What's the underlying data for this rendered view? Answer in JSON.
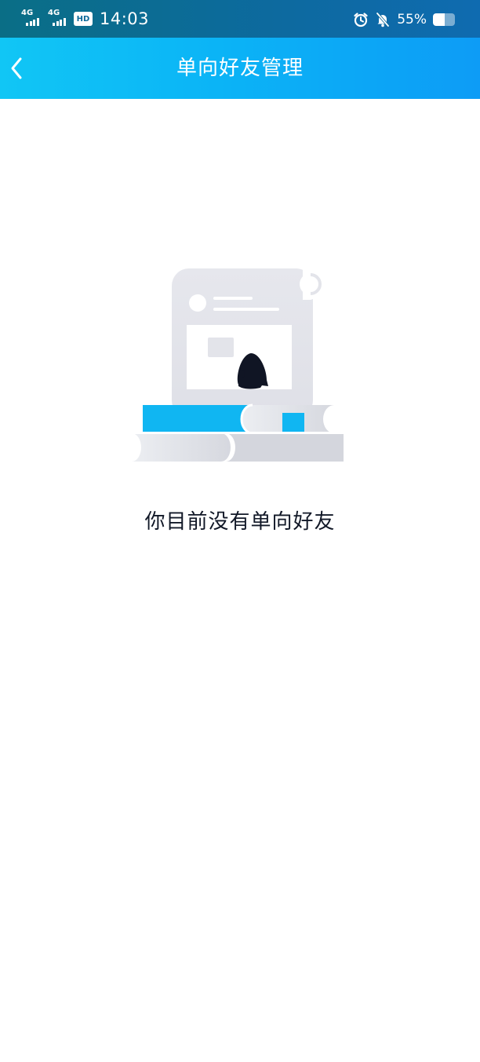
{
  "status_bar": {
    "network_1": "4G",
    "network_2": "4G",
    "hd_badge": "HD",
    "time": "14:03",
    "battery_percent_text": "55%",
    "battery_level": 0.55,
    "icons": [
      "signal-icon",
      "alarm-icon",
      "mute-icon",
      "battery-icon"
    ]
  },
  "nav": {
    "title": "单向好友管理",
    "back_icon": "chevron-left-icon"
  },
  "empty_state": {
    "illustration": "empty-scroll-books-illustration",
    "message": "你目前没有单向好友"
  },
  "colors": {
    "status_bar": "#0d6a9a",
    "nav_gradient_start": "#11c6f5",
    "nav_gradient_end": "#0d9cf6",
    "accent": "#10b6f2",
    "text": "#111827",
    "illustration_gray": "#e3e4ea"
  }
}
